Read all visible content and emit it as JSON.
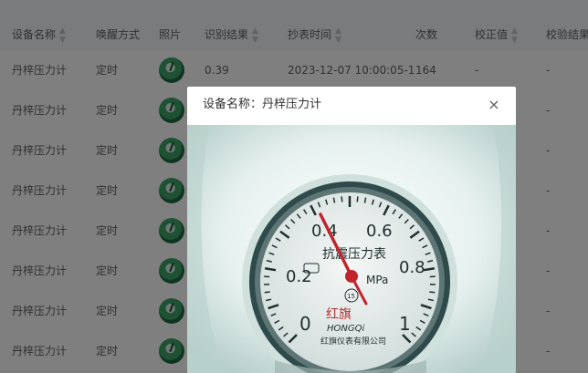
{
  "table": {
    "columns": [
      {
        "label": "设备名称",
        "sortable": true
      },
      {
        "label": "唤醒方式",
        "sortable": false
      },
      {
        "label": "照片",
        "sortable": false
      },
      {
        "label": "识别结果",
        "sortable": true
      },
      {
        "label": "抄表时间",
        "sortable": true
      },
      {
        "label": "次数",
        "sortable": false
      },
      {
        "label": "校正值",
        "sortable": true
      },
      {
        "label": "校验结果",
        "sortable": true
      }
    ],
    "rows": [
      {
        "name": "丹梓压力计",
        "wake": "定时",
        "result": "0.39",
        "time": "2023-12-07 10:00:05-1",
        "count": "164",
        "correction": "-",
        "check": "-"
      },
      {
        "name": "丹梓压力计",
        "wake": "定时",
        "result": "",
        "time": "",
        "count": "",
        "correction": "",
        "check": "-"
      },
      {
        "name": "丹梓压力计",
        "wake": "定时",
        "result": "",
        "time": "",
        "count": "",
        "correction": "",
        "check": "-"
      },
      {
        "name": "丹梓压力计",
        "wake": "定时",
        "result": "",
        "time": "",
        "count": "",
        "correction": "",
        "check": "-"
      },
      {
        "name": "丹梓压力计",
        "wake": "定时",
        "result": "",
        "time": "",
        "count": "",
        "correction": "",
        "check": "-"
      },
      {
        "name": "丹梓压力计",
        "wake": "定时",
        "result": "",
        "time": "",
        "count": "",
        "correction": "",
        "check": "-"
      },
      {
        "name": "丹梓压力计",
        "wake": "定时",
        "result": "",
        "time": "",
        "count": "",
        "correction": "",
        "check": "-"
      },
      {
        "name": "丹梓压力计",
        "wake": "定时",
        "result": "",
        "time": "",
        "count": "",
        "correction": "",
        "check": "-"
      }
    ]
  },
  "modal": {
    "title": "设备名称：丹梓压力计",
    "close_glyph": "×",
    "gauge": {
      "scale_labels": [
        "0",
        "0.2",
        "0.4",
        "0.6",
        "0.8",
        "1"
      ],
      "dial_title": "抗震压力表",
      "unit": "MPa",
      "badge": "15",
      "brand_script": "红旗",
      "brand": "HONGQi",
      "maker": "红旗仪表有限公司"
    }
  }
}
